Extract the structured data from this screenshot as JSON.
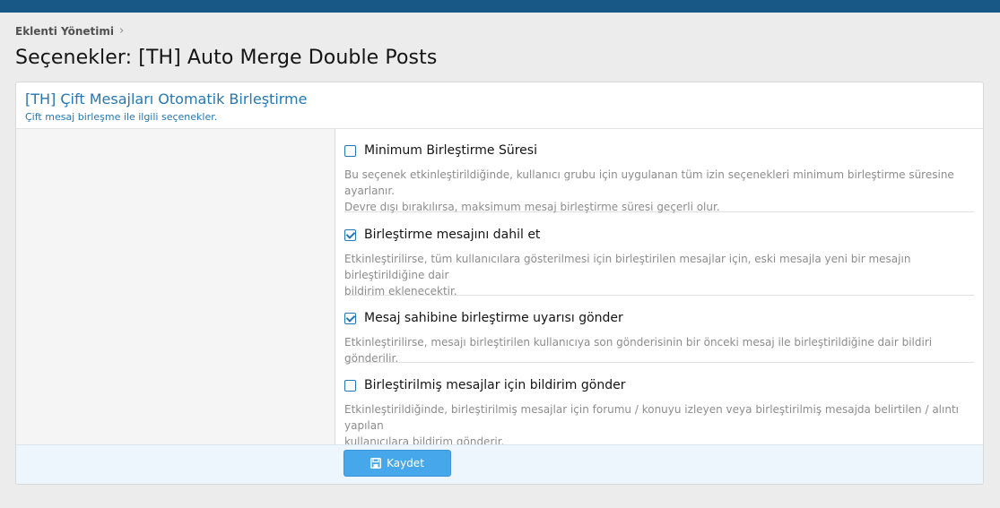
{
  "breadcrumb": {
    "item": "Eklenti Yönetimi",
    "separator": "›"
  },
  "page": {
    "title": "Seçenekler: [TH] Auto Merge Double Posts"
  },
  "block": {
    "title": "[TH] Çift Mesajları Otomatik Birleştirme",
    "description": "Çift mesaj birleşme ile ilgili seçenekler."
  },
  "options": [
    {
      "label": "Minimum Birleştirme Süresi",
      "checked": false,
      "desc_line1": "Bu seçenek etkinleştirildiğinde, kullanıcı grubu için uygulanan tüm izin seçenekleri minimum birleştirme süresine ayarlanır.",
      "desc_line2": "Devre dışı bırakılırsa, maksimum mesaj birleştirme süresi geçerli olur."
    },
    {
      "label": "Birleştirme mesajını dahil et",
      "checked": true,
      "desc_line1": "Etkinleştirilirse, tüm kullanıcılara gösterilmesi için birleştirilen mesajlar için, eski mesajla yeni bir mesajın birleştirildiğine dair",
      "desc_line2": "bildirim eklenecektir."
    },
    {
      "label": "Mesaj sahibine birleştirme uyarısı gönder",
      "checked": true,
      "desc_line1": "Etkinleştirilirse, mesajı birleştirilen kullanıcıya son gönderisinin bir önceki mesaj ile birleştirildiğine dair bildiri gönderilir.",
      "desc_line2": ""
    },
    {
      "label": "Birleştirilmiş mesajlar için bildirim gönder",
      "checked": false,
      "desc_line1": "Etkinleştirildiğinde, birleştirilmiş mesajlar için forumu / konuyu izleyen veya birleştirilmiş mesajda belirtilen / alıntı yapılan",
      "desc_line2": "kullanıcılara bildirim gönderir."
    }
  ],
  "footer": {
    "save_label": "Kaydet",
    "save_icon": "save-icon"
  },
  "colors": {
    "topbar": "#185886",
    "accent": "#2577b1",
    "button": "#47a7eb"
  }
}
